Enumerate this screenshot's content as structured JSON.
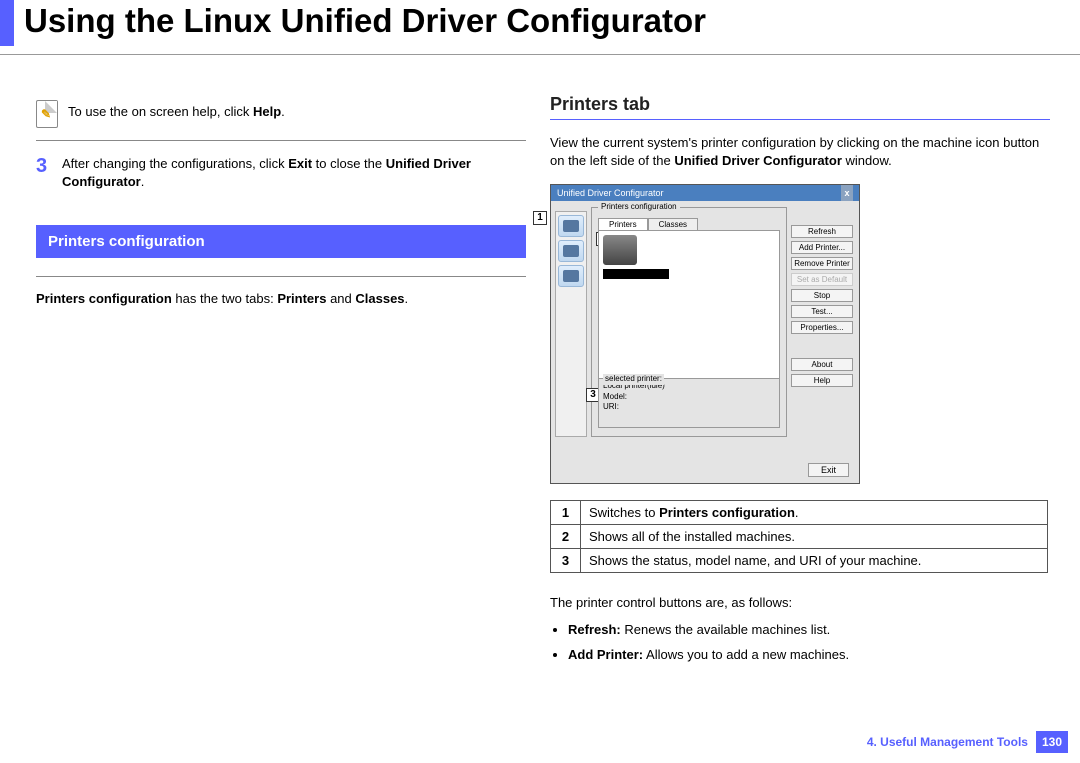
{
  "pageTitle": "Using the Linux Unified Driver Configurator",
  "note": {
    "prefix": "To use the on screen help, click ",
    "boldWord": "Help",
    "suffix": "."
  },
  "step": {
    "number": "3",
    "prefix": "After changing the configurations, click ",
    "bold1": "Exit",
    "mid": " to close the ",
    "bold2": "Unified Driver Configurator",
    "suffix": "."
  },
  "sectionHeading": "Printers configuration",
  "subPara": {
    "bold1": "Printers configuration",
    "mid": " has the two tabs: ",
    "bold2": "Printers",
    "and": " and ",
    "bold3": "Classes",
    "suffix": "."
  },
  "right": {
    "heading": "Printers tab",
    "para": {
      "text1": "View the current system's printer configuration by clicking on the machine icon button on the left side of the ",
      "bold": "Unified Driver Configurator",
      "text2": " window."
    }
  },
  "screenshot": {
    "windowTitle": "Unified Driver Configurator",
    "groupLabel": "Printers configuration",
    "tabs": {
      "printers": "Printers",
      "classes": "Classes"
    },
    "buttons": [
      "Refresh",
      "Add Printer...",
      "Remove Printer",
      "Set as Default",
      "Stop",
      "Test...",
      "Properties...",
      "About",
      "Help"
    ],
    "disabledIndex": 3,
    "selectedLabel": "selected printer:",
    "selectedLines": [
      "Local printer(idle)",
      "Model:",
      "URI:"
    ],
    "exit": "Exit",
    "callouts": [
      "1",
      "2",
      "3"
    ]
  },
  "table": [
    {
      "n": "1",
      "prefix": "Switches to ",
      "bold": "Printers configuration",
      "suffix": "."
    },
    {
      "n": "2",
      "text": "Shows all of the installed machines."
    },
    {
      "n": "3",
      "text": "Shows the status, model name, and URI of your machine."
    }
  ],
  "follow": "The printer control buttons are, as follows:",
  "bullets": [
    {
      "bold": "Refresh:",
      "text": " Renews the available machines list."
    },
    {
      "bold": "Add Printer:",
      "text": " Allows you to add a new machines."
    }
  ],
  "footer": {
    "chapter": "4.  Useful Management Tools",
    "page": "130"
  }
}
